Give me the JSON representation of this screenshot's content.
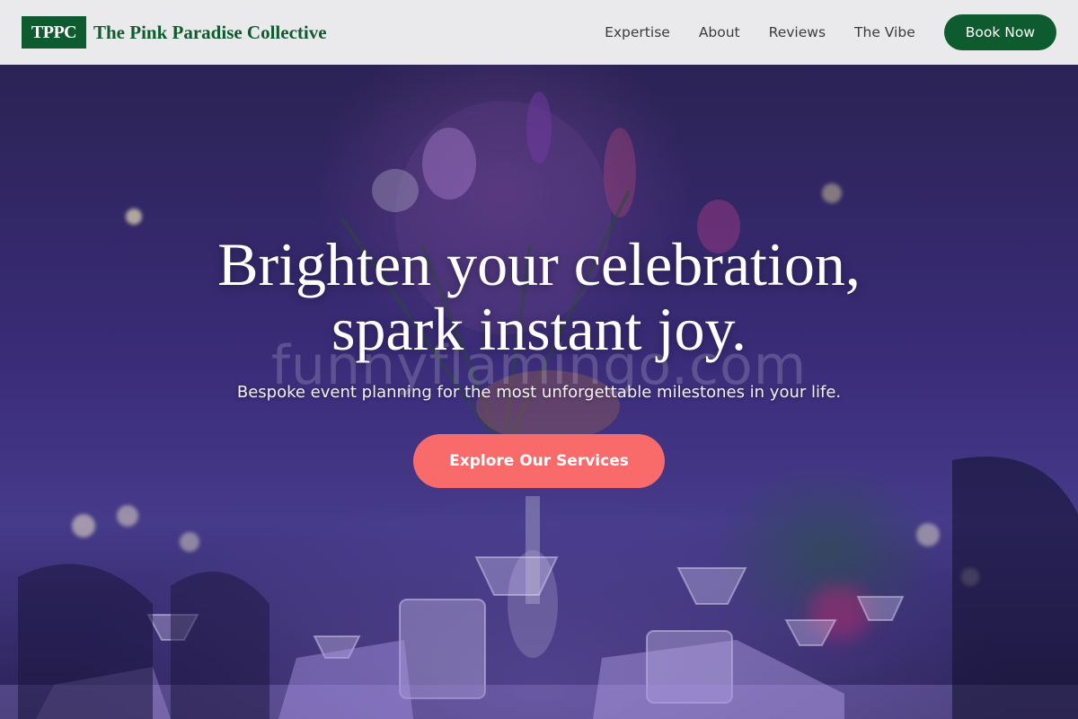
{
  "header": {
    "logo_badge": "TPPC",
    "brand_name": "The Pink Paradise Collective",
    "nav": [
      {
        "label": "Expertise"
      },
      {
        "label": "About"
      },
      {
        "label": "Reviews"
      },
      {
        "label": "The Vibe"
      }
    ],
    "cta_label": "Book Now"
  },
  "hero": {
    "title_line1": "Brighten your celebration,",
    "title_line2": "spark instant joy.",
    "subtitle": "Bespoke event planning for the most unforgettable milestones in your life.",
    "watermark": "funnyflamingo.com",
    "cta_label": "Explore Our Services"
  },
  "colors": {
    "brand_green": "#0d5b2f",
    "header_bg": "#eaeaec",
    "cta_coral": "#f96b6b",
    "hero_purple": "#3a2c78"
  }
}
